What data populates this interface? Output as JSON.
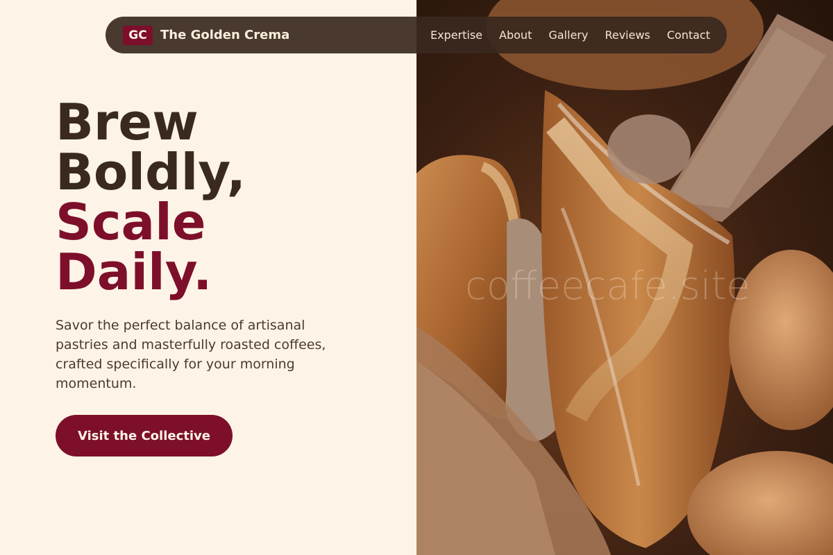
{
  "nav": {
    "brand_badge": "GC",
    "brand_name": "The Golden Crema",
    "links": [
      "Expertise",
      "About",
      "Gallery",
      "Reviews",
      "Contact"
    ]
  },
  "hero": {
    "headline_lines": [
      "Brew",
      "Boldly,",
      "Scale",
      "Daily."
    ],
    "description": "Savor the perfect balance of artisanal pastries and masterfully roasted coffees, crafted specifically for your morning momentum.",
    "cta_label": "Visit the Collective"
  },
  "image": {
    "watermark": "coffeecafe.site"
  },
  "colors": {
    "background": "#fdf4e7",
    "accent": "#7d0f2a",
    "dark_text": "#3a2a1e",
    "nav_background": "#3a281e"
  }
}
